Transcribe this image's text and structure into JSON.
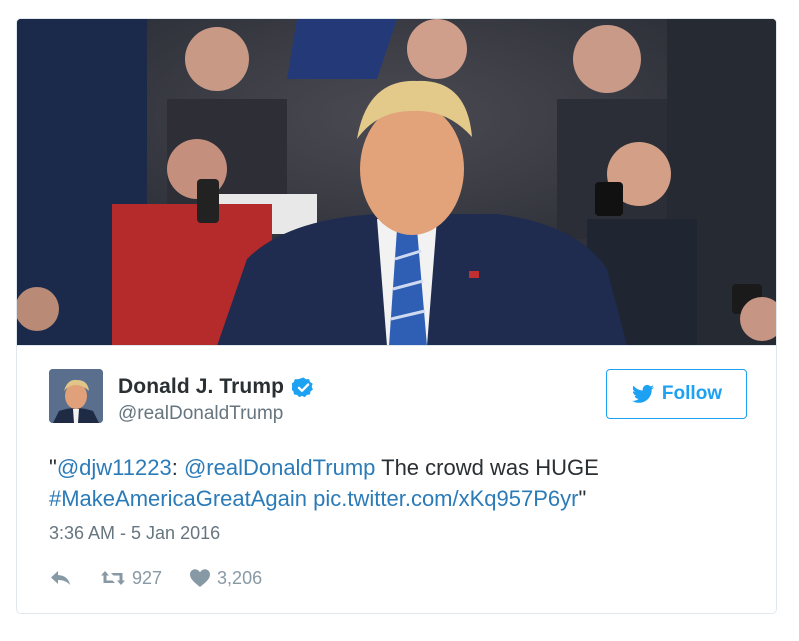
{
  "user": {
    "name": "Donald J. Trump",
    "handle": "@realDonaldTrump"
  },
  "follow_button": {
    "label": "Follow"
  },
  "tweet": {
    "open_quote": "\"",
    "mention_1": "@djw11223",
    "separator": ": ",
    "mention_2": "@realDonaldTrump",
    "body": " The crowd was HUGE",
    "hashtag": "#MakeAmericaGreatAgain",
    "space": " ",
    "link": "pic.twitter.com/xKq957P6yr",
    "close_quote": "\""
  },
  "timestamp": "3:36 AM - 5 Jan 2016",
  "stats": {
    "retweets": "927",
    "likes": "3,206"
  },
  "icons": {
    "verified": "verified-badge-icon",
    "follow": "twitter-bird-icon",
    "reply": "reply-icon",
    "retweet": "retweet-icon",
    "like": "heart-icon"
  },
  "colors": {
    "link": "#2b7bb9",
    "accent": "#1da1f2",
    "muted": "#66757f",
    "action": "#8899a6"
  }
}
